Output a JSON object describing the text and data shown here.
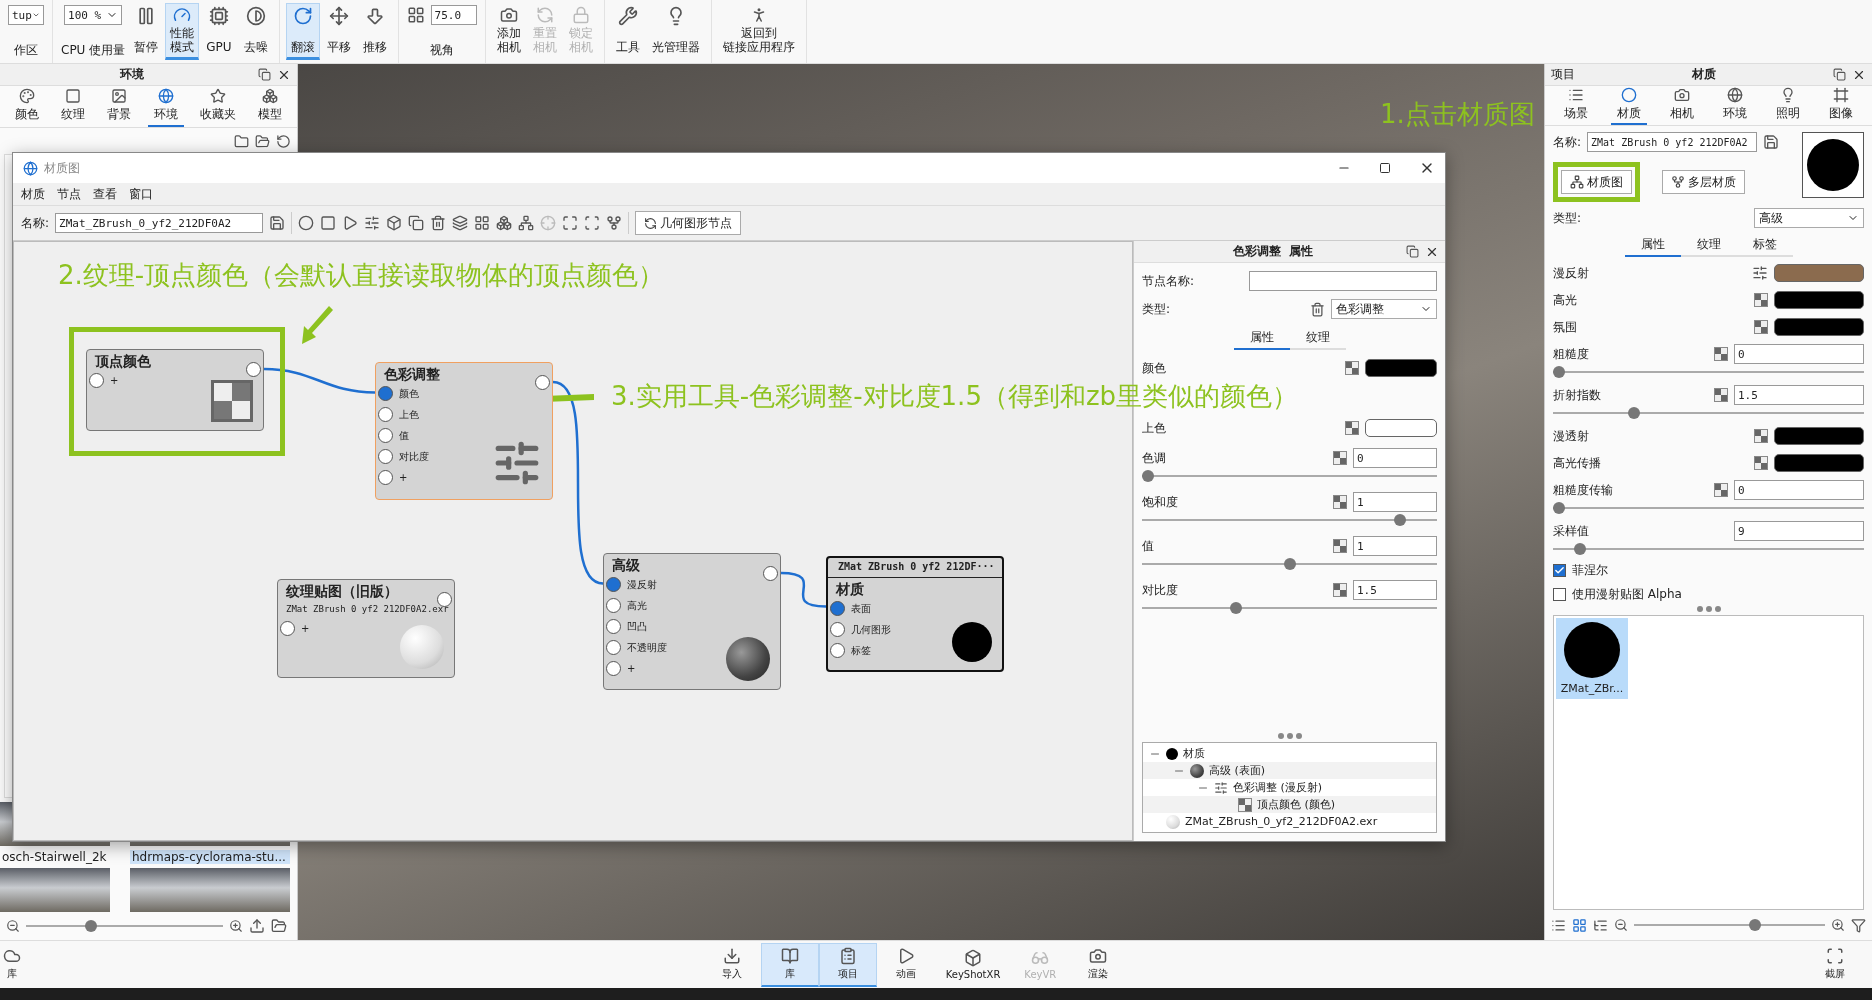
{
  "toolbar": [
    [
      {
        "kind": "combo",
        "value": "tup",
        "label": "作区"
      }
    ],
    [
      {
        "kind": "combo",
        "value": "100 %",
        "label": "CPU 使用量"
      },
      {
        "kind": "button",
        "label": [
          "暂停"
        ],
        "selected": false,
        "disabled": false
      },
      {
        "kind": "button",
        "label": [
          "性能",
          "模式"
        ],
        "selected": true,
        "disabled": false
      },
      {
        "kind": "button",
        "label": [
          "GPU"
        ],
        "selected": false,
        "disabled": false
      },
      {
        "kind": "button",
        "label": [
          "去噪"
        ],
        "selected": false,
        "disabled": false
      }
    ],
    [
      {
        "kind": "button",
        "label": [
          "翻滚"
        ],
        "selected": true,
        "disabled": false
      },
      {
        "kind": "button",
        "label": [
          "平移"
        ],
        "selected": false,
        "disabled": false
      },
      {
        "kind": "button",
        "label": [
          "推移"
        ],
        "selected": false,
        "disabled": false
      }
    ],
    [
      {
        "kind": "field",
        "value": "75.0",
        "label": "视角"
      }
    ],
    [
      {
        "kind": "button",
        "label": [
          "添加",
          "相机"
        ],
        "selected": false,
        "disabled": false
      },
      {
        "kind": "button",
        "label": [
          "重置",
          "相机"
        ],
        "selected": false,
        "disabled": true
      },
      {
        "kind": "button",
        "label": [
          "锁定",
          "相机"
        ],
        "selected": false,
        "disabled": true
      }
    ],
    [
      {
        "kind": "button",
        "label": [
          "工具"
        ],
        "selected": false,
        "disabled": false
      },
      {
        "kind": "button",
        "label": [
          "光管理器"
        ],
        "selected": false,
        "disabled": false
      }
    ],
    [
      {
        "kind": "button",
        "label": [
          "返回到",
          "链接应用程序"
        ],
        "selected": false,
        "disabled": false
      }
    ]
  ],
  "left_panel": {
    "title": "环境",
    "tabs": [
      {
        "label": "颜色",
        "selected": false
      },
      {
        "label": "纹理",
        "selected": false
      },
      {
        "label": "背景",
        "selected": false
      },
      {
        "label": "环境",
        "selected": true
      },
      {
        "label": "收藏夹",
        "selected": false
      },
      {
        "label": "模型",
        "selected": false
      }
    ],
    "thumbnails": [
      {
        "label": "osch-Stairwell_2k",
        "selected": false
      },
      {
        "label": "hdrmaps-cyclorama-stu...",
        "selected": true
      }
    ]
  },
  "viewport": {
    "annotation": "1.点击材质图"
  },
  "material_graph": {
    "title": "材质图",
    "menu": [
      "材质",
      "节点",
      "查看",
      "窗口"
    ],
    "name_label": "名称:",
    "name_value": "ZMat_ZBrush_0_yf2_212DF0A2",
    "geometry_button": "几何图形节点",
    "annotations": [
      "2.纹理-顶点颜色（会默认直接读取物体的顶点颜色）",
      "3.实用工具-色彩调整-对比度1.5（得到和zb里类似的颜色）"
    ],
    "nodes": [
      {
        "kind": "texture",
        "title": "顶点颜色",
        "highlighted": true,
        "selected": false,
        "inputs": [
          {
            "label": "+",
            "connected": false
          }
        ]
      },
      {
        "kind": "utility",
        "title": "色彩调整",
        "highlighted": false,
        "selected": true,
        "inputs": [
          {
            "label": "颜色",
            "connected": true
          },
          {
            "label": "上色",
            "connected": false
          },
          {
            "label": "值",
            "connected": false
          },
          {
            "label": "对比度",
            "connected": false
          },
          {
            "label": "+",
            "connected": false
          }
        ]
      },
      {
        "kind": "texture",
        "title": "纹理贴图（旧版）",
        "subtitle": "ZMat ZBrush 0 yf2 212DF0A2.exr",
        "highlighted": false,
        "selected": false,
        "inputs": [
          {
            "label": "+",
            "connected": false
          }
        ]
      },
      {
        "kind": "material",
        "title": "高级",
        "highlighted": false,
        "selected": false,
        "inputs": [
          {
            "label": "漫反射",
            "connected": true
          },
          {
            "label": "高光",
            "connected": false
          },
          {
            "label": "凹凸",
            "connected": false
          },
          {
            "label": "不透明度",
            "connected": false
          },
          {
            "label": "+",
            "connected": false
          }
        ]
      },
      {
        "kind": "output",
        "header": "ZMat ZBrush 0 yf2 212DF···",
        "title": "材质",
        "highlighted": false,
        "selected": false,
        "inputs": [
          {
            "label": "表面",
            "connected": true
          },
          {
            "label": "几何图形",
            "connected": false
          },
          {
            "label": "标签",
            "connected": false
          }
        ]
      }
    ],
    "properties": {
      "title": "色彩调整  属性",
      "node_name_label": "节点名称:",
      "type_label": "类型:",
      "type_value": "色彩调整",
      "tabs": [
        {
          "label": "属性",
          "selected": true
        },
        {
          "label": "纹理",
          "selected": false
        }
      ],
      "rows": [
        {
          "kind": "color",
          "label": "颜色",
          "color": "#000000"
        },
        {
          "kind": "color",
          "label": "上色",
          "color": "#ffffff"
        },
        {
          "kind": "number",
          "label": "色调",
          "value": "0",
          "level": 0
        },
        {
          "kind": "number",
          "label": "饱和度",
          "value": "1",
          "level": 0.89
        },
        {
          "kind": "number",
          "label": "值",
          "value": "1",
          "level": 0.5
        },
        {
          "kind": "number",
          "label": "对比度",
          "value": "1.5",
          "level": 0.31
        }
      ],
      "tree": [
        {
          "kind": "material",
          "label": "材质",
          "expanded": true,
          "children": [
            {
              "kind": "advanced",
              "label": "高级 (表面)",
              "expanded": true,
              "children": [
                {
                  "kind": "utility",
                  "label": "色彩调整 (漫反射)",
                  "expanded": true,
                  "children": [
                    {
                      "kind": "texture",
                      "label": "顶点颜色 (颜色)"
                    }
                  ]
                }
              ]
            }
          ]
        },
        {
          "kind": "file",
          "label": "ZMat_ZBrush_0_yf2_212DF0A2.exr"
        }
      ]
    }
  },
  "right_panel": {
    "left_title": "项目",
    "title": "材质",
    "tabs": [
      {
        "label": "场景",
        "selected": false
      },
      {
        "label": "材质",
        "selected": true
      },
      {
        "label": "相机",
        "selected": false
      },
      {
        "label": "环境",
        "selected": false
      },
      {
        "label": "照明",
        "selected": false
      },
      {
        "label": "图像",
        "selected": false
      }
    ],
    "name_label": "名称:",
    "name_value": "ZMat_ZBrush_0_yf2_212DF0A2",
    "buttons": [
      {
        "label": "材质图",
        "highlighted": true
      },
      {
        "label": "多层材质",
        "highlighted": false
      }
    ],
    "type_label": "类型:",
    "type_value": "高级",
    "subtabs": [
      {
        "label": "属性",
        "selected": true
      },
      {
        "label": "纹理",
        "selected": false
      },
      {
        "label": "标签",
        "selected": false
      }
    ],
    "rows": [
      {
        "kind": "linked-color",
        "label": "漫反射",
        "color": "#8b6b4e"
      },
      {
        "kind": "color",
        "label": "高光",
        "color": "#000000"
      },
      {
        "kind": "color",
        "label": "氛围",
        "color": "#000000"
      },
      {
        "kind": "number",
        "label": "粗糙度",
        "value": "0",
        "level": 0
      },
      {
        "kind": "number",
        "label": "折射指数",
        "value": "1.5",
        "level": 0.25
      },
      {
        "kind": "color",
        "label": "漫透射",
        "color": "#000000"
      },
      {
        "kind": "color",
        "label": "高光传播",
        "color": "#000000"
      },
      {
        "kind": "number",
        "label": "粗糙度传输",
        "value": "0",
        "level": 0
      },
      {
        "kind": "count",
        "label": "采样值",
        "value": "9",
        "level": 0.07
      },
      {
        "kind": "checkbox",
        "label": "菲涅尔",
        "checked": true
      },
      {
        "kind": "checkbox",
        "label": "使用漫射贴图 Alpha",
        "checked": false
      }
    ],
    "library": [
      {
        "label": "ZMat_ZBr...",
        "selected": true
      }
    ]
  },
  "bottom_bar": {
    "left": "库",
    "items": [
      {
        "label": "导入",
        "selected": false,
        "disabled": false
      },
      {
        "label": "库",
        "selected": true,
        "disabled": false
      },
      {
        "label": "项目",
        "selected": true,
        "disabled": false
      },
      {
        "label": "动画",
        "selected": false,
        "disabled": false
      },
      {
        "label": "KeyShotXR",
        "selected": false,
        "disabled": false
      },
      {
        "label": "KeyVR",
        "selected": false,
        "disabled": true
      },
      {
        "label": "渲染",
        "selected": false,
        "disabled": false
      }
    ],
    "right": "截屏"
  }
}
